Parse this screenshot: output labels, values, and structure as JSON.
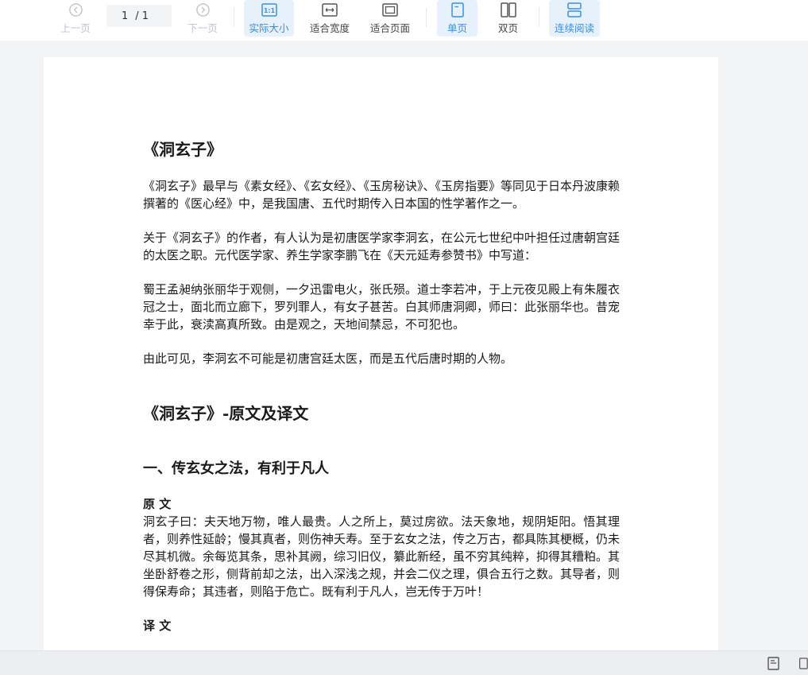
{
  "toolbar": {
    "prev_label": "上一页",
    "next_label": "下一页",
    "page_current": "1",
    "page_total": "/ 1",
    "actual_size_label": "实际大小",
    "fit_width_label": "适合宽度",
    "fit_page_label": "适合页面",
    "single_page_label": "单页",
    "double_page_label": "双页",
    "continuous_label": "连续阅读"
  },
  "colors": {
    "accent": "#3b8fe0",
    "active_bg": "#e6f1fb",
    "disabled": "#c0c4cc"
  },
  "document": {
    "title": "《洞玄子》",
    "para1": "《洞玄子》最早与《素女经》、《玄女经》、《玉房秘诀》、《玉房指要》等同见于日本丹波康赖撰著的《医心经》中，是我国唐、五代时期传入日本国的性学著作之一。",
    "para2": "关于《洞玄子》的作者，有人认为是初唐医学家李洞玄，在公元七世纪中叶担任过唐朝宫廷的太医之职。元代医学家、养生学家李鹏飞在《天元延寿参赞书》中写道：",
    "para3": "蜀王孟昶纳张丽华于观侧，一夕迅雷电火，张氏殒。道士李若冲，于上元夜见殿上有朱履衣冠之士，面北而立廊下，罗列罪人，有女子甚苦。白其师唐洞卿，师曰：此张丽华也。昔宠幸于此，衰渎高真所致。由是观之，天地间禁忌，不可犯也。",
    "para4": "由此可见，李洞玄不可能是初唐宫廷太医，而是五代后唐时期的人物。",
    "heading2": "《洞玄子》-原文及译文",
    "section1_title": "一、传玄女之法，有利于凡人",
    "original_label": "原 文",
    "original_text": "洞玄子曰：夫天地万物，唯人最贵。人之所上，莫过房欲。法天象地，规阴矩阳。悟其理者，则养性延龄；慢其真者，则伤神夭寿。至于玄女之法，传之万古，都具陈其梗概，仍未尽其机微。余每览其条，思补其阙，综习旧仪，纂此新经，虽不穷其纯粹，抑得其糟粕。其坐卧舒卷之形，侧背前却之法，出入深浅之规，并会二仪之理，俱合五行之数。其导者，则得保寿命；其违者，则陷于危亡。既有利于凡人，岂无传于万叶！",
    "translation_label": "译 文"
  }
}
